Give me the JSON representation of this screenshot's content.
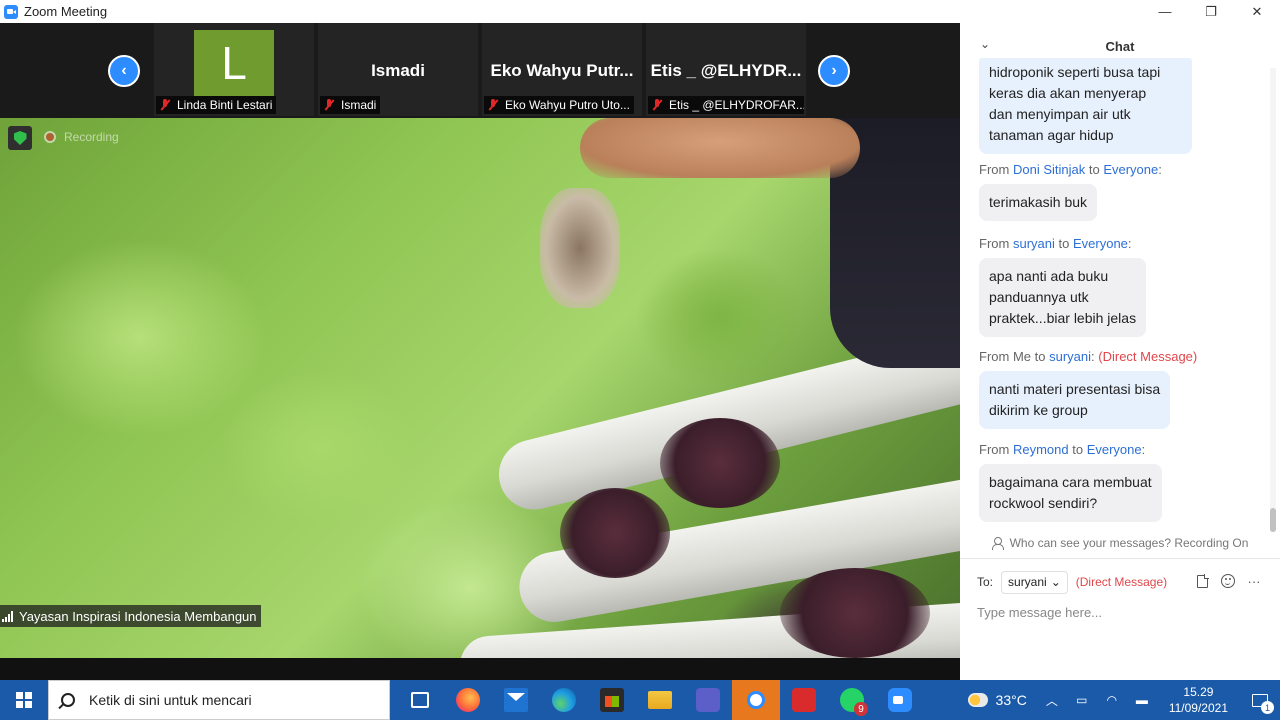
{
  "window": {
    "title": "Zoom Meeting",
    "minimize": "—",
    "maximize": "❐",
    "close": "✕"
  },
  "participants": [
    {
      "avatar_letter": "L",
      "display": "",
      "label": "Linda Binti Lestari"
    },
    {
      "display": "Ismadi",
      "label": "Ismadi"
    },
    {
      "display": "Eko Wahyu Putr...",
      "label": "Eko Wahyu Putro Uto..."
    },
    {
      "display": "Etis _ @ELHYDR...",
      "label": "Etis _ @ELHYDROFAR..."
    }
  ],
  "video": {
    "recording_label": "Recording",
    "speaker_name": "Yayasan Inspirasi Indonesia Membangun"
  },
  "chat": {
    "title": "Chat",
    "messages": [
      {
        "text_lines": [
          "hidroponik seperti busa tapi",
          "keras dia akan menyerap",
          "dan menyimpan air utk",
          "tanaman agar hidup"
        ]
      },
      {
        "from_prefix": "From",
        "from": "Doni Sitinjak",
        "to_prefix": "to",
        "to": "Everyone",
        "suffix": ":",
        "dm": "",
        "text_lines": [
          "terimakasih buk"
        ]
      },
      {
        "from_prefix": "From",
        "from": "suryani",
        "to_prefix": "to",
        "to": "Everyone",
        "suffix": ":",
        "dm": "",
        "text_lines": [
          "apa nanti ada buku",
          "panduannya utk",
          "praktek...biar lebih jelas"
        ]
      },
      {
        "from_prefix": "From Me",
        "from": "",
        "to_prefix": "to",
        "to": "suryani",
        "suffix": ":",
        "dm": "(Direct Message)",
        "text_lines": [
          "nanti materi presentasi bisa",
          "dikirim ke group"
        ]
      },
      {
        "from_prefix": "From",
        "from": "Reymond",
        "to_prefix": "to",
        "to": "Everyone",
        "suffix": ":",
        "dm": "",
        "text_lines": [
          "bagaimana cara membuat",
          "rockwool sendiri?"
        ]
      }
    ],
    "visibility_note": "Who can see your messages? Recording On",
    "to_label": "To:",
    "to_selected": "suryani",
    "to_dm": "(Direct Message)",
    "input_placeholder": "Type message here...",
    "more_label": "···"
  },
  "taskbar": {
    "search_placeholder": "Ketik di sini untuk mencari",
    "whatsapp_badge": "9",
    "temperature": "33°C",
    "time": "15.29",
    "date": "11/09/2021",
    "notification_count": "1"
  }
}
